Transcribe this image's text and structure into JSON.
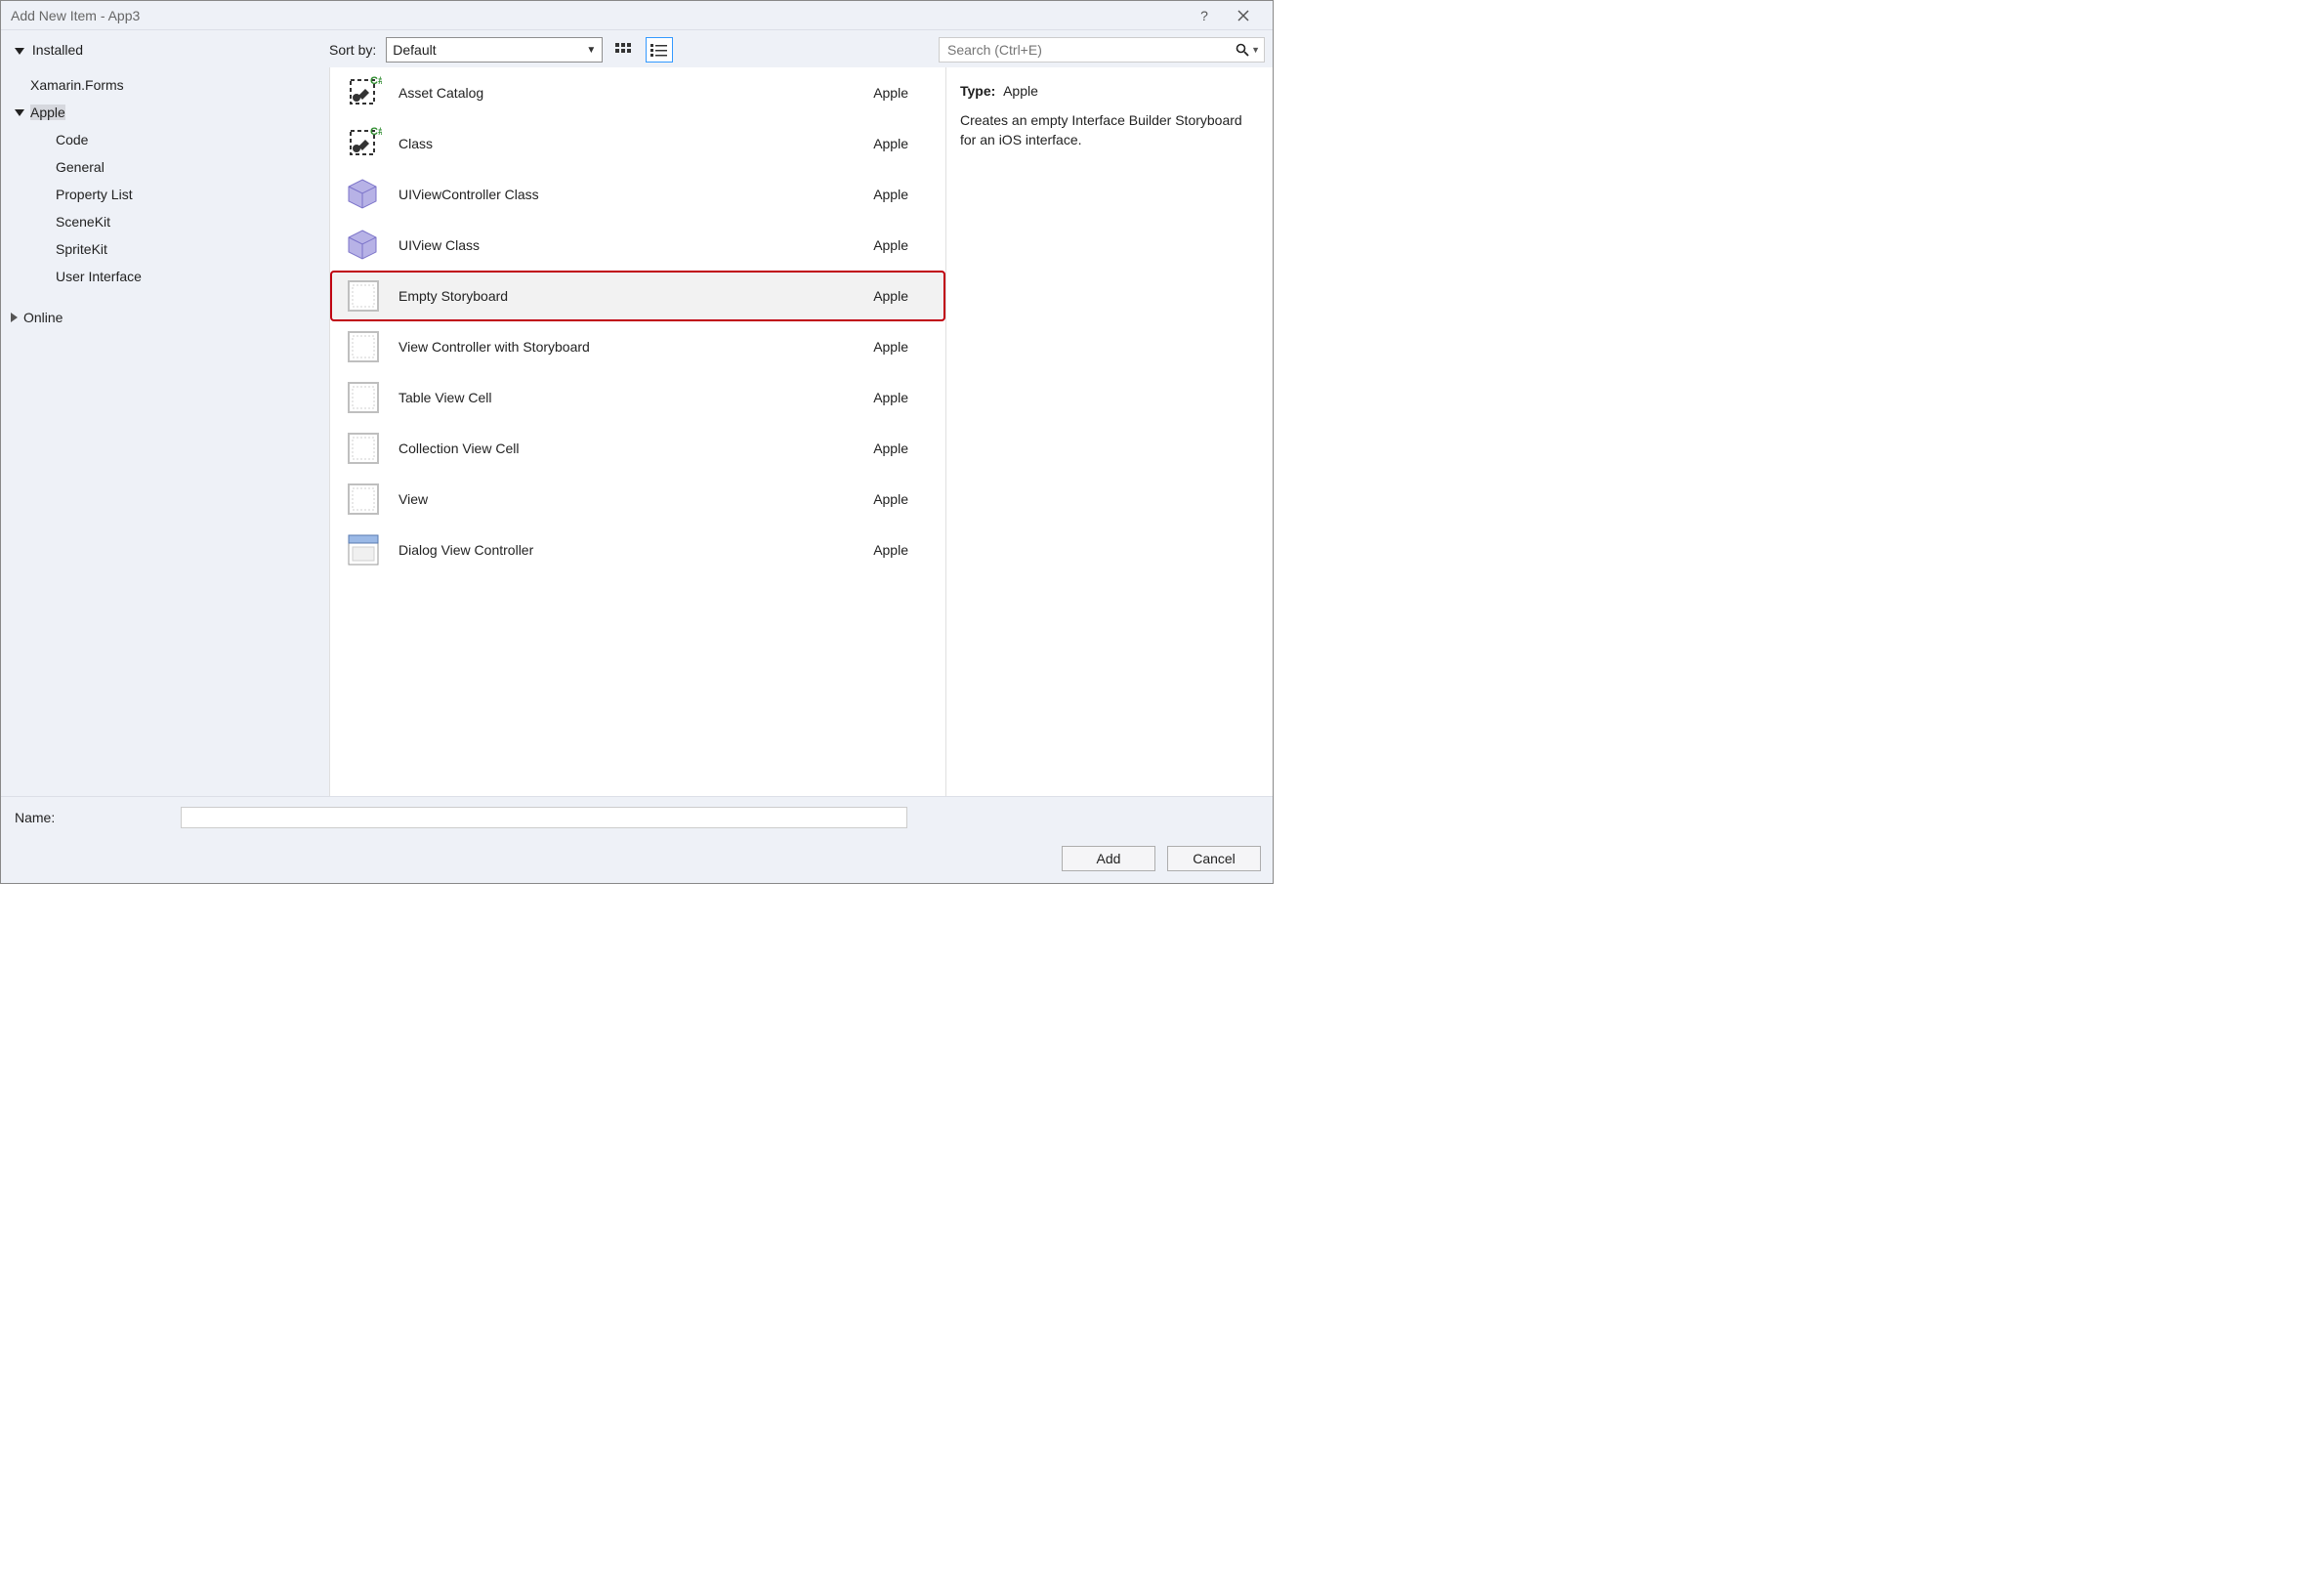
{
  "window": {
    "title": "Add New Item - App3"
  },
  "sort": {
    "label": "Sort by:",
    "value": "Default"
  },
  "search": {
    "placeholder": "Search (Ctrl+E)"
  },
  "tree": {
    "installed_label": "Installed",
    "items": [
      {
        "label": "Xamarin.Forms"
      },
      {
        "label": "Apple",
        "selected": true,
        "children": [
          {
            "label": "Code"
          },
          {
            "label": "General"
          },
          {
            "label": "Property List"
          },
          {
            "label": "SceneKit"
          },
          {
            "label": "SpriteKit"
          },
          {
            "label": "User Interface"
          }
        ]
      }
    ],
    "online_label": "Online"
  },
  "templates": [
    {
      "name": "Asset Catalog",
      "group": "Apple",
      "icon": "cs"
    },
    {
      "name": "Class",
      "group": "Apple",
      "icon": "cs"
    },
    {
      "name": "UIViewController Class",
      "group": "Apple",
      "icon": "cube"
    },
    {
      "name": "UIView Class",
      "group": "Apple",
      "icon": "cube"
    },
    {
      "name": "Empty Storyboard",
      "group": "Apple",
      "icon": "sb",
      "highlighted": true
    },
    {
      "name": "View Controller with Storyboard",
      "group": "Apple",
      "icon": "sb"
    },
    {
      "name": "Table View Cell",
      "group": "Apple",
      "icon": "sb"
    },
    {
      "name": "Collection View Cell",
      "group": "Apple",
      "icon": "sb"
    },
    {
      "name": "View",
      "group": "Apple",
      "icon": "sb"
    },
    {
      "name": "Dialog View Controller",
      "group": "Apple",
      "icon": "window"
    }
  ],
  "details": {
    "type_label": "Type:",
    "type_value": "Apple",
    "description": "Creates an empty Interface Builder Storyboard for an iOS interface."
  },
  "bottom": {
    "name_label": "Name:",
    "name_value": "",
    "add_label": "Add",
    "cancel_label": "Cancel"
  }
}
